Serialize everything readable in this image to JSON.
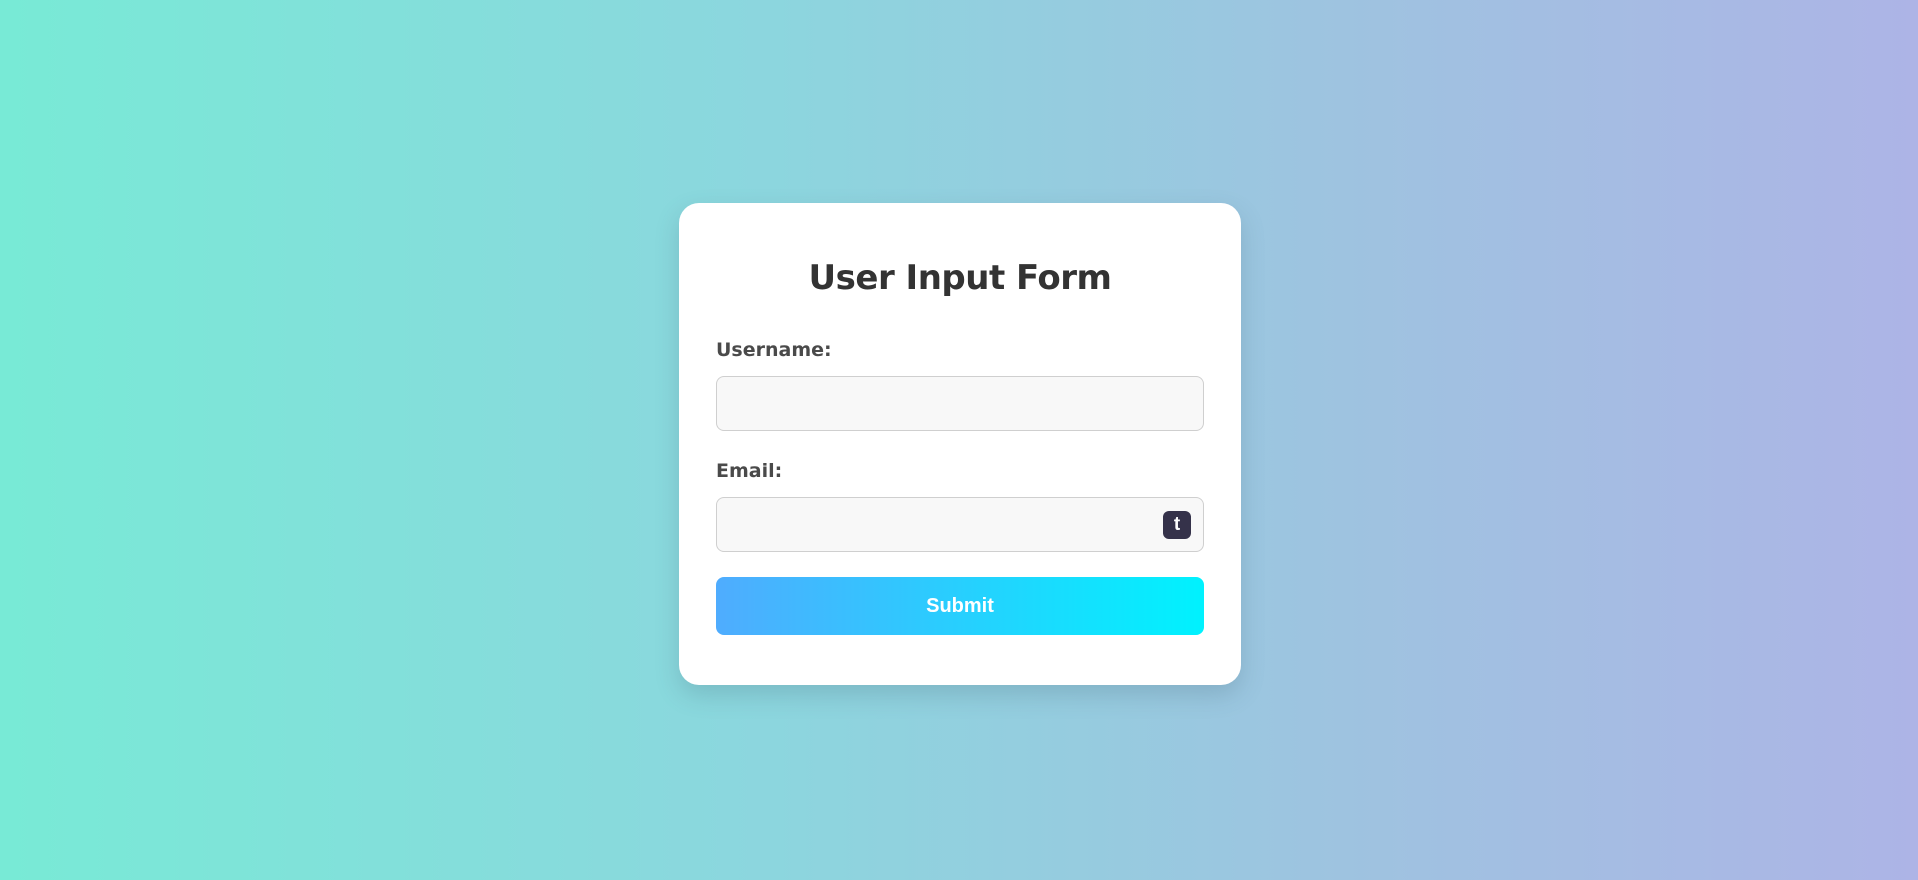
{
  "form": {
    "title": "User Input Form",
    "username_label": "Username:",
    "username_value": "",
    "email_label": "Email:",
    "email_value": "",
    "extension_badge_glyph": "t",
    "submit_label": "Submit"
  },
  "colors": {
    "background_gradient": [
      "#78ead6",
      "#adb4e6"
    ],
    "button_gradient": [
      "#4facfe",
      "#00f2fe"
    ],
    "title_text": "#333333",
    "badge_background": "#35324a"
  },
  "icons": {
    "email_field_badge": "tumblr-icon"
  }
}
